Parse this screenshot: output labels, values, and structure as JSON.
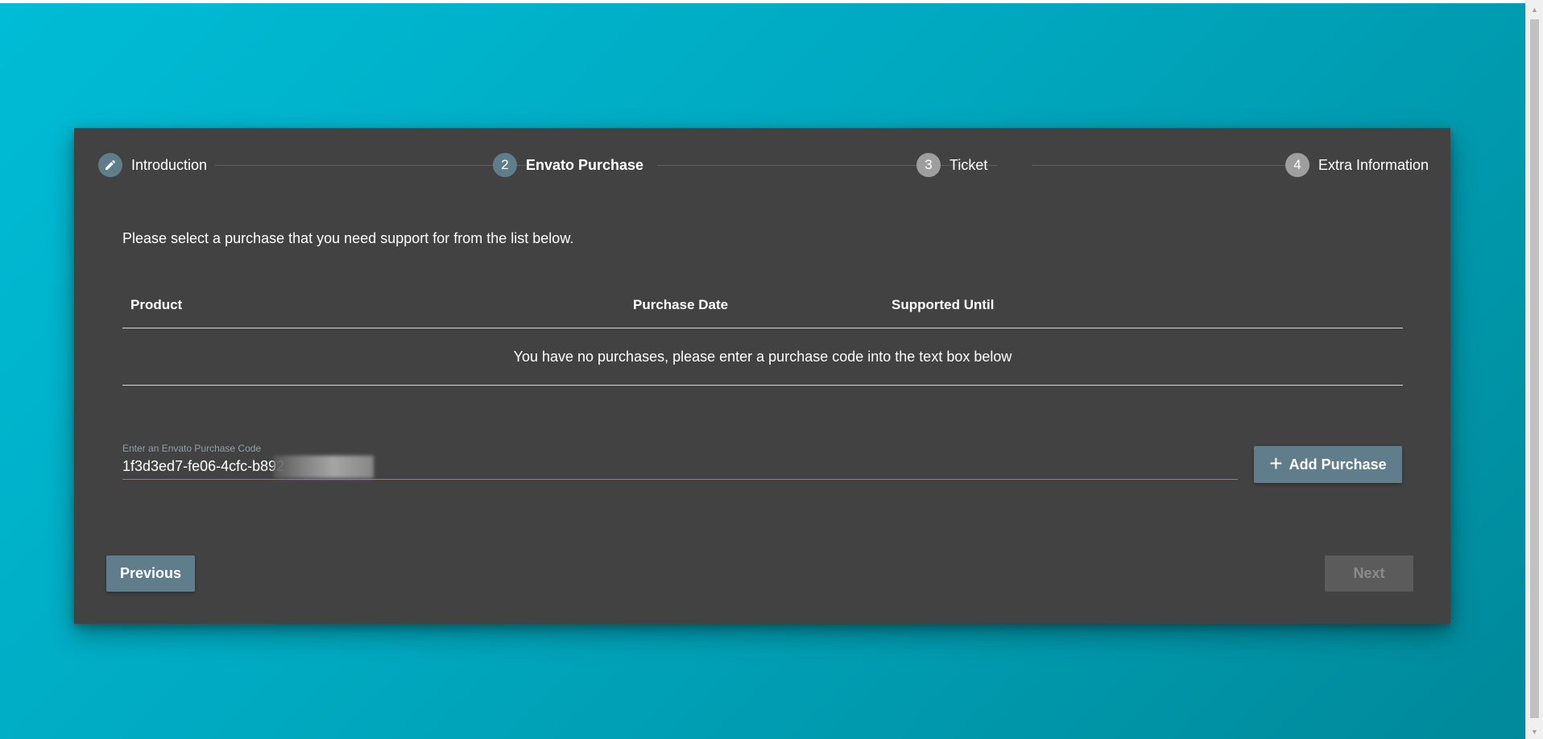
{
  "stepper": {
    "steps": [
      {
        "number": "",
        "label": "Introduction",
        "state": "done",
        "icon": "pencil-icon"
      },
      {
        "number": "2",
        "label": "Envato Purchase",
        "state": "active"
      },
      {
        "number": "3",
        "label": "Ticket",
        "state": "idle"
      },
      {
        "number": "4",
        "label": "Extra Information",
        "state": "idle"
      }
    ]
  },
  "main": {
    "instruction": "Please select a purchase that you need support for from the list below.",
    "table": {
      "columns": [
        "Product",
        "Purchase Date",
        "Supported Until"
      ],
      "empty_message": "You have no purchases, please enter a purchase code into the text box below"
    },
    "purchase_code": {
      "label": "Enter an Envato Purchase Code",
      "value": "1f3d3ed7-fe06-4cfc-b892"
    },
    "add_button": {
      "label": "Add Purchase",
      "icon": "plus-icon"
    }
  },
  "footer": {
    "previous_label": "Previous",
    "next_label": "Next"
  },
  "colors": {
    "background_start": "#00bcd6",
    "background_end": "#00899a",
    "card": "#424242",
    "accent": "#607d8b"
  }
}
